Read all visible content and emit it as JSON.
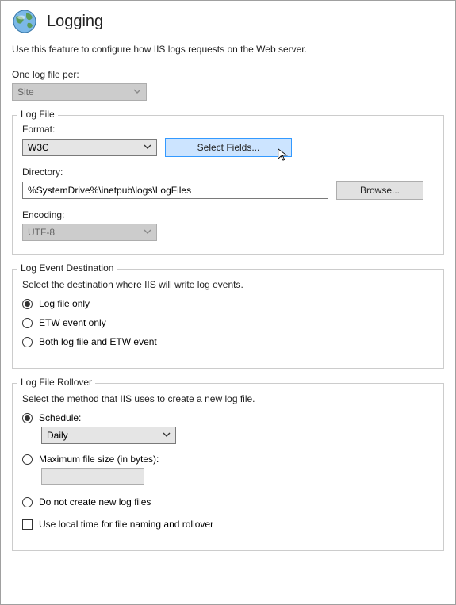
{
  "header": {
    "title": "Logging",
    "icon": "globe-icon"
  },
  "description": "Use this feature to configure how IIS logs requests on the Web server.",
  "per_log": {
    "label": "One log file per:",
    "value": "Site"
  },
  "log_file": {
    "legend": "Log File",
    "format_label": "Format:",
    "format_value": "W3C",
    "select_fields_btn": "Select Fields...",
    "directory_label": "Directory:",
    "directory_value": "%SystemDrive%\\inetpub\\logs\\LogFiles",
    "browse_btn": "Browse...",
    "encoding_label": "Encoding:",
    "encoding_value": "UTF-8"
  },
  "destination": {
    "legend": "Log Event Destination",
    "desc": "Select the destination where IIS will write log events.",
    "options": {
      "file_only": "Log file only",
      "etw_only": "ETW event only",
      "both": "Both log file and ETW event"
    },
    "selected": "file_only"
  },
  "rollover": {
    "legend": "Log File Rollover",
    "desc": "Select the method that IIS uses to create a new log file.",
    "schedule_label": "Schedule:",
    "schedule_value": "Daily",
    "max_size_label": "Maximum file size (in bytes):",
    "no_create_label": "Do not create new log files",
    "use_local_time_label": "Use local time for file naming and rollover",
    "selected": "schedule"
  }
}
